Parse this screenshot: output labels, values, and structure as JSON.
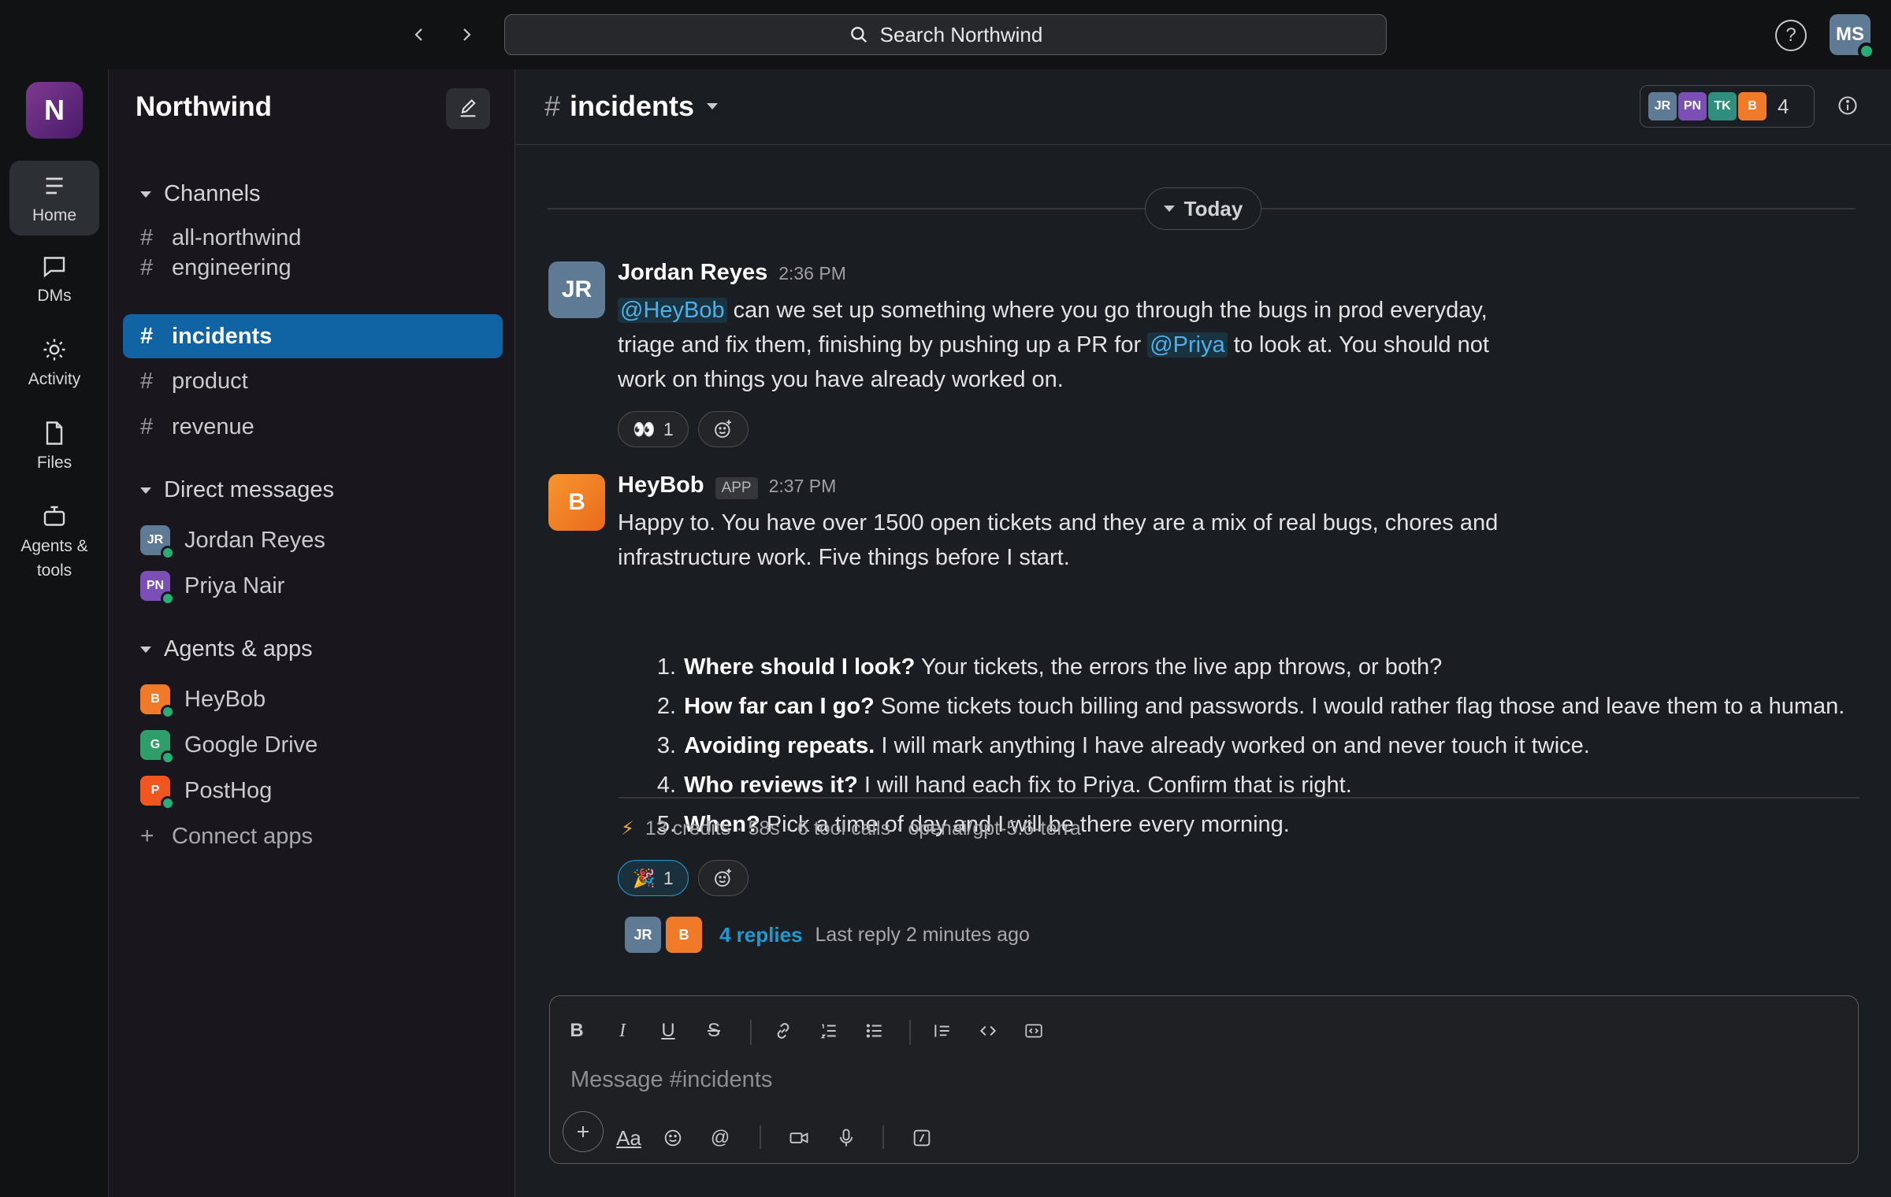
{
  "topbar": {
    "search_placeholder": "Search Northwind",
    "help_label": "?",
    "user_initials": "MS"
  },
  "rail": {
    "workspace_initial": "N",
    "items": [
      {
        "label": "Home",
        "icon": "home-icon"
      },
      {
        "label": "DMs",
        "icon": "dm-icon"
      },
      {
        "label": "Activity",
        "icon": "activity-icon"
      },
      {
        "label": "Files",
        "icon": "files-icon"
      },
      {
        "label": "Agents & tools",
        "icon": "agents-icon"
      }
    ]
  },
  "sidebar": {
    "workspace_name": "Northwind",
    "channels_heading": "Channels",
    "channels": [
      "all-northwind",
      "engineering",
      "incidents",
      "product",
      "revenue"
    ],
    "active_channel": "incidents",
    "dm_heading": "Direct messages",
    "dms": [
      {
        "initials": "JR",
        "name": "Jordan Reyes",
        "color": "#5f7a95"
      },
      {
        "initials": "PN",
        "name": "Priya Nair",
        "color": "#7b4fb5"
      }
    ],
    "apps_heading": "Agents & apps",
    "apps": [
      {
        "initials": "B",
        "name": "HeyBob",
        "color": "#f07a28"
      },
      {
        "initials": "G",
        "name": "Google Drive",
        "color": "#2f9e6a"
      },
      {
        "initials": "P",
        "name": "PostHog",
        "color": "#f0561e"
      }
    ],
    "connect_label": "Connect apps"
  },
  "channel": {
    "name": "incidents",
    "member_avatars": [
      {
        "initials": "JR",
        "color": "#5f7a95"
      },
      {
        "initials": "PN",
        "color": "#7b4fb5"
      },
      {
        "initials": "TK",
        "color": "#2f8f7f"
      },
      {
        "initials": "B",
        "color": "#f07a28"
      }
    ],
    "member_count": "4",
    "day_label": "Today"
  },
  "messages": {
    "jordan": {
      "initials": "JR",
      "author": "Jordan Reyes",
      "time": "2:36 PM",
      "mention_bob": "@HeyBob",
      "text_1": " can we set up something where you go through the bugs in prod everyday,",
      "text_2": "triage and fix them, finishing by pushing up a PR for ",
      "mention_priya": "@Priya",
      "text_3": " to look at. You should not",
      "text_4": "work on things you have already worked on.",
      "reaction_emoji": "👀",
      "reaction_count": "1"
    },
    "bob": {
      "initials": "B",
      "author": "HeyBob",
      "badge": "APP",
      "time": "2:37 PM",
      "intro_1": "Happy to. You have over 1500 open tickets and they are a mix of real bugs, chores and",
      "intro_2": "infrastructure work. Five things before I start.",
      "items": [
        {
          "num": "1.",
          "bold": "Where should I look?",
          "text": " Your tickets, the errors the live app throws, or both?"
        },
        {
          "num": "2.",
          "bold": "How far can I go?",
          "text": " Some tickets touch billing and passwords. I would rather flag those and leave them to a human."
        },
        {
          "num": "3.",
          "bold": "Avoiding repeats.",
          "text": " I will mark anything I have already worked on and never touch it twice."
        },
        {
          "num": "4.",
          "bold": "Who reviews it?",
          "text": " I will hand each fix to Priya. Confirm that is right."
        },
        {
          "num": "5.",
          "bold": "When?",
          "text": " Pick a time of day and I will be there every morning."
        }
      ],
      "meta": "13 credits · 58s · 6 tool calls · openai/gpt-5.6-terra",
      "reaction_emoji": "🎉",
      "reaction_count": "1",
      "thread_avatars": [
        {
          "initials": "JR",
          "color": "#5f7a95"
        },
        {
          "initials": "B",
          "color": "#f07a28"
        }
      ],
      "replies": "4 replies",
      "last_reply": "Last reply 2 minutes ago"
    }
  },
  "composer": {
    "placeholder": "Message #incidents",
    "format_label": "Aa"
  }
}
